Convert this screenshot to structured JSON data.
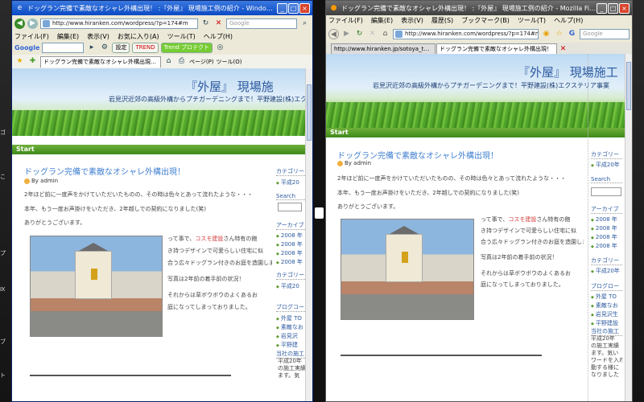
{
  "desktop": {
    "icons": [
      "ゴ",
      "こ",
      "プ",
      "Ⅸ",
      "ブ",
      "ト"
    ]
  },
  "ie": {
    "title": "ドッグラン完備で素敵なオシャレ外構出現！ :『外屋』 現場施工例の紹介 - Windows Internet ...",
    "address": "http://www.hiranken.com/wordpress/?p=174#m",
    "search_placeholder": "Google",
    "menu": [
      "ファイル(F)",
      "編集(E)",
      "表示(V)",
      "お気に入り(A)",
      "ツール(T)",
      "ヘルプ(H)"
    ],
    "google_label": "Google",
    "settings_label": "設定",
    "trend_label": "Trend プロテクト",
    "tab_title": "ドッグラン完備で素敵なオシャレ外構出現！ :『外",
    "page_menu": "ページ(P)",
    "tools_menu": "ツール(O)"
  },
  "ff": {
    "title": "ドッグラン完備で素敵なオシャレ外構出現！ :『外屋』 現場施工例の紹介 - Mozilla Firefox",
    "menu": [
      "ファイル(F)",
      "編集(E)",
      "表示(V)",
      "履歴(S)",
      "ブックマーク(B)",
      "ツール(T)",
      "ヘルプ(H)"
    ],
    "address": "http://www.hiranken.com/wordpress/?p=174#m",
    "search_placeholder": "Google",
    "tabs": [
      "http://www.hiranken.jp/sotoya_top.html",
      "ドッグラン完備で素敵なオシャレ外構出現！"
    ]
  },
  "site": {
    "title_ie": "『外屋』 現場施",
    "title_ff": "『外屋』 現場施工",
    "desc_ie": "岩見沢近郊の高級外構からプチガーデニングまで！平野建設(株)エクステリア事",
    "desc_ff": "岩見沢近郊の高級外構からプチガーデニングまで！平野建設(株)エクステリア事業",
    "start": "Start",
    "post_title": "ドッグラン完備で素敵なオシャレ外構出現！",
    "author": "By admin",
    "p1": "2年ほど前に一度声をかけていただいたものの、その時は色々とあって流れたような・・・",
    "p2": "本年、もう一度お声掛けをいただき、2年越しでの契約になりました(笑)",
    "p3": "ありがとうございます。",
    "float1": "って事で、",
    "float1_hl": "コスモ建設",
    "float1b": "さん特有の飽",
    "float2": "き持つデザインで可愛らしい住宅に似",
    "float3": "合う広々ドッグラン付きのお庭を造園",
    "float3b": "します。",
    "float4": "写真は2年前の着手前の状況！",
    "float5": "それからは草ボウボウのよくあるお",
    "float6": "庭になってしまっておりました。"
  },
  "sidebar_ie": {
    "h_category": "カテゴリー",
    "cat_item": "平成20",
    "h_search": "Search",
    "h_archive": "アーカイブ",
    "archives": [
      "2008 年",
      "2008 年",
      "2008 年",
      "2008 年"
    ],
    "h_cat2": "カテゴリー",
    "cat2_item": "平成20",
    "h_blog": "ブログコー",
    "blogs": [
      "外屋 TO",
      "素敵なお",
      "岩見沢",
      "平野建"
    ],
    "h_gaisha": "当社の施工",
    "gaisha_text": [
      "平成20年",
      "の施工実績",
      "ます。気"
    ]
  },
  "sidebar_ff": {
    "h_category": "カテゴリー",
    "cat_item": "平成20年",
    "h_search": "Search",
    "h_archive": "アーカイブ",
    "archives": [
      "2008 年",
      "2008 年",
      "2008 年",
      "2008 年"
    ],
    "h_cat2": "カテゴリー",
    "cat2_item": "平成20年",
    "h_blog": "ブログロー",
    "blogs": [
      "外屋 TO",
      "素敵なお",
      "岩見沢生",
      "平野建設"
    ],
    "h_gaisha": "当社の施工",
    "gaisha_text": [
      "平成20年",
      "の施工実績",
      "ます。気い",
      "ワードを入れ",
      "動する様に",
      "なりました"
    ]
  }
}
